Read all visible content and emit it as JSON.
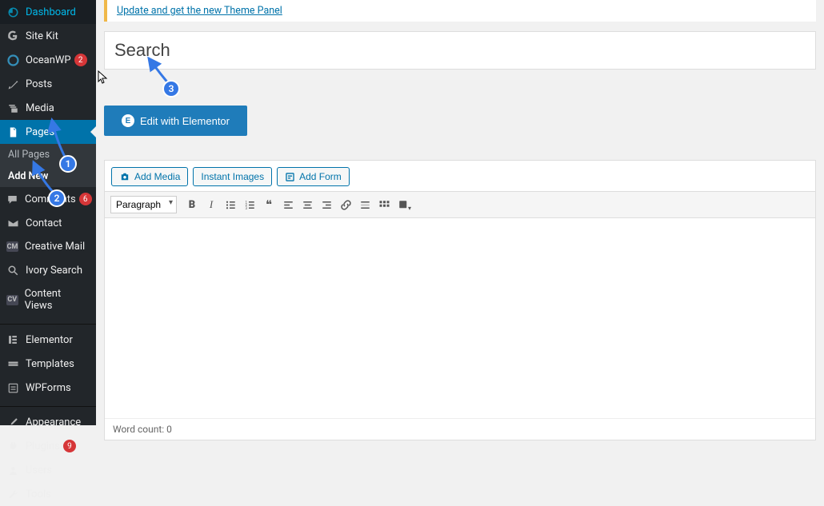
{
  "notice_link": "Update and get the new Theme Panel",
  "title_placeholder": "Search",
  "elementor_btn": "Edit with Elementor",
  "media_buttons": {
    "add_media": "Add Media",
    "instant_images": "Instant Images",
    "add_form": "Add Form"
  },
  "format_select": "Paragraph",
  "word_count_label": "Word count: 0",
  "sidebar": {
    "dashboard": "Dashboard",
    "sitekit": "Site Kit",
    "oceanwp": "OceanWP",
    "oceanwp_badge": "2",
    "posts": "Posts",
    "media": "Media",
    "pages": "Pages",
    "pages_sub": {
      "all": "All Pages",
      "add": "Add New"
    },
    "comments": "Comments",
    "comments_badge": "6",
    "contact": "Contact",
    "creative_mail": "Creative Mail",
    "ivory": "Ivory Search",
    "content_views": "Content Views",
    "elementor": "Elementor",
    "templates": "Templates",
    "wpforms": "WPForms",
    "appearance": "Appearance",
    "plugins": "Plugins",
    "plugins_badge": "9",
    "users": "Users",
    "tools": "Tools"
  },
  "annotations": {
    "n1": "1",
    "n2": "2",
    "n3": "3"
  }
}
